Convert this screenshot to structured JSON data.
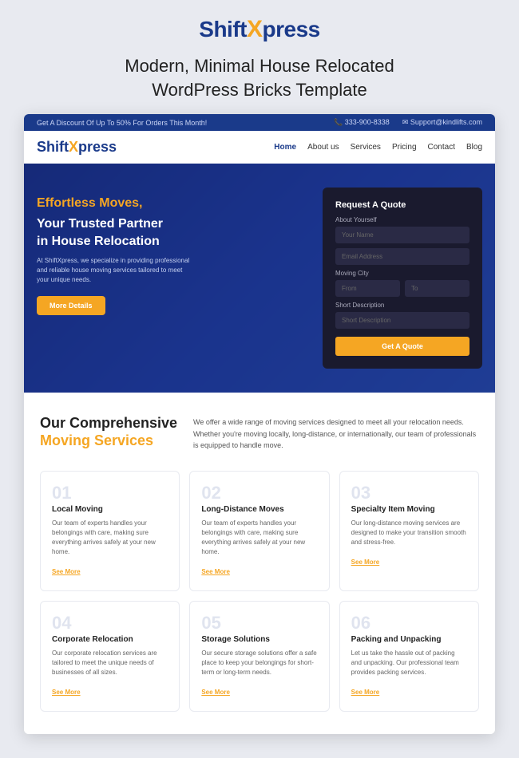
{
  "brand": {
    "name_part1": "Shift",
    "name_x": "X",
    "name_part2": "press"
  },
  "tagline": {
    "line1": "Modern, Minimal  House Relocated",
    "line2": "WordPress  Bricks Template"
  },
  "topbar": {
    "promo": "Get A Discount Of Up To 50% For Orders This Month!",
    "phone": "📞 333-900-8338",
    "email": "✉ Support@kindlifts.com"
  },
  "nav": {
    "logo_part1": "Shift",
    "logo_x": "X",
    "logo_part2": "press",
    "links": [
      "Home",
      "About us",
      "Services",
      "Pricing",
      "Contact",
      "Blog"
    ]
  },
  "hero": {
    "heading_accent": "Effortless Moves,",
    "heading_main": "Your Trusted Partner\nin House Relocation",
    "subtext": "At ShiftXpress, we specialize in providing professional and reliable house moving services tailored to meet your unique needs.",
    "btn_label": "More Details",
    "form": {
      "title": "Request A Quote",
      "section_label": "About Yourself",
      "fields": {
        "name_placeholder": "Your Name",
        "email_placeholder": "Email Address",
        "city_label": "Moving City",
        "from_placeholder": "From",
        "to_placeholder": "To",
        "desc_label": "Short Description",
        "desc_placeholder": "Short Description"
      },
      "btn_label": "Get A Quote"
    }
  },
  "services": {
    "title_line1": "Our Comprehensive",
    "title_line2": "Moving Services",
    "description": "We offer a wide range of moving services designed to meet all your relocation needs. Whether you're moving locally, long-distance, or internationally, our team of professionals is equipped to handle move.",
    "cards": [
      {
        "num": "01",
        "name": "Local Moving",
        "desc": "Our team of experts handles your belongings with care, making sure everything arrives safely at your new home.",
        "link": "See More"
      },
      {
        "num": "02",
        "name": "Long-Distance Moves",
        "desc": "Our team of experts handles your belongings with care, making sure everything arrives safely at your new home.",
        "link": "See More"
      },
      {
        "num": "03",
        "name": "Specialty Item Moving",
        "desc": "Our long-distance moving services are designed to make your transition smooth and stress-free.",
        "link": "See More"
      },
      {
        "num": "04",
        "name": "Corporate Relocation",
        "desc": "Our corporate relocation services are tailored to meet the unique needs of businesses of all sizes.",
        "link": "See More"
      },
      {
        "num": "05",
        "name": "Storage Solutions",
        "desc": "Our secure storage solutions offer a safe place to keep your belongings for short-term or long-term needs.",
        "link": "See More"
      },
      {
        "num": "06",
        "name": "Packing and Unpacking",
        "desc": "Let us take the hassle out of packing and unpacking. Our professional team provides packing services.",
        "link": "See More"
      }
    ]
  }
}
